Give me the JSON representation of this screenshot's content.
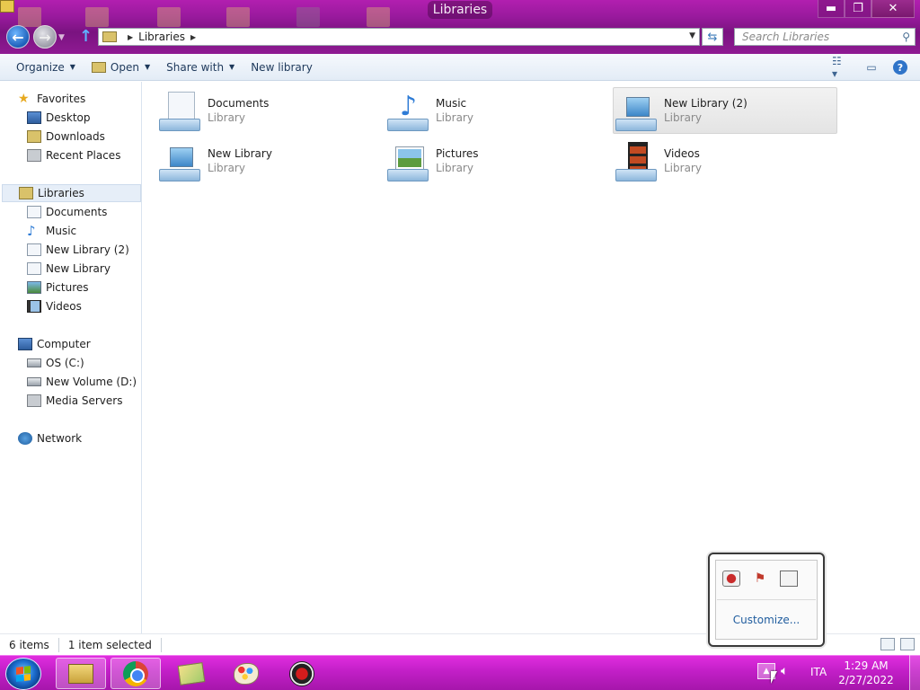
{
  "window": {
    "title": "Libraries",
    "caption": {
      "minimize": "▬",
      "maximize": "❐",
      "close": "✕"
    }
  },
  "address_bar": {
    "path": [
      "Libraries"
    ],
    "search_placeholder": "Search Libraries"
  },
  "toolbar": {
    "organize": "Organize",
    "open": "Open",
    "share_with": "Share with",
    "new_library": "New library"
  },
  "sidebar": {
    "favorites": {
      "label": "Favorites",
      "items": [
        "Desktop",
        "Downloads",
        "Recent Places"
      ]
    },
    "libraries": {
      "label": "Libraries",
      "items": [
        "Documents",
        "Music",
        "New Library (2)",
        "New Library",
        "Pictures",
        "Videos"
      ]
    },
    "computer": {
      "label": "Computer",
      "items": [
        "OS (C:)",
        "New Volume (D:)",
        "Media Servers"
      ]
    },
    "network": {
      "label": "Network"
    }
  },
  "libraries_grid": [
    {
      "name": "Documents",
      "type": "Library",
      "icon": "documents-library-icon",
      "selected": false
    },
    {
      "name": "Music",
      "type": "Library",
      "icon": "music-library-icon",
      "selected": false
    },
    {
      "name": "New Library (2)",
      "type": "Library",
      "icon": "library-icon",
      "selected": true
    },
    {
      "name": "New Library",
      "type": "Library",
      "icon": "library-icon",
      "selected": false
    },
    {
      "name": "Pictures",
      "type": "Library",
      "icon": "pictures-library-icon",
      "selected": false
    },
    {
      "name": "Videos",
      "type": "Library",
      "icon": "videos-library-icon",
      "selected": false
    }
  ],
  "status": {
    "count": "6 items",
    "selection": "1 item selected"
  },
  "tray_popup": {
    "icons": [
      "record-tray-icon",
      "action-center-flag-icon",
      "network-tray-icon"
    ],
    "customize": "Customize..."
  },
  "taskbar": {
    "apps": [
      "windows-explorer",
      "google-chrome",
      "folder",
      "paint",
      "recorder"
    ],
    "language": "ITA",
    "time": "1:29 AM",
    "date": "2/27/2022"
  },
  "colors": {
    "titlebar": "#9a1a9e",
    "taskbar": "#c21fc7",
    "link": "#1f5c9e",
    "selection": "#e6eef8"
  }
}
